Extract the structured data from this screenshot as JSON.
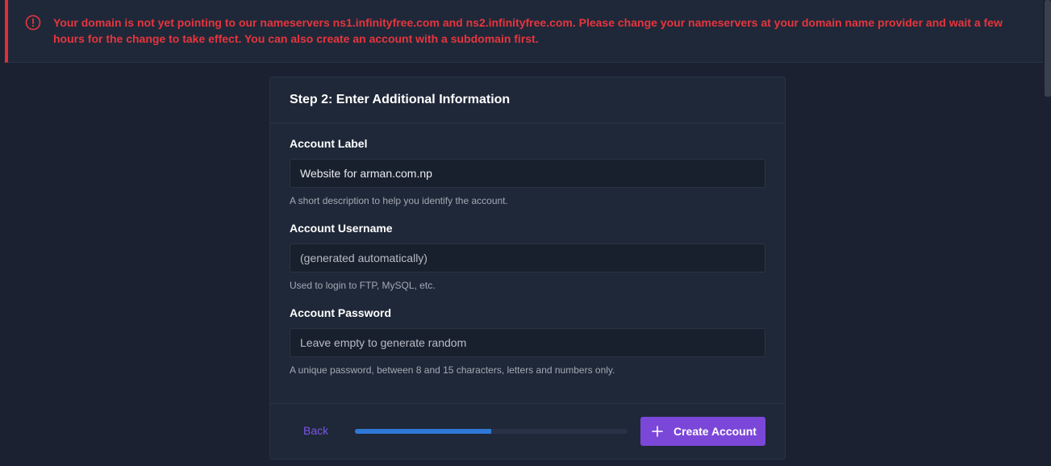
{
  "alert": {
    "icon": "alert-circle-icon",
    "message": "Your domain is not yet pointing to our nameservers ns1.infinityfree.com and ns2.infinityfree.com. Please change your nameservers at your domain name provider and wait a few hours for the change to take effect. You can also create an account with a subdomain first.",
    "color": "#e6353f"
  },
  "card": {
    "title": "Step 2: Enter Additional Information"
  },
  "fields": {
    "label": {
      "label": "Account Label",
      "value": "Website for arman.com.np",
      "placeholder": "",
      "help": "A short description to help you identify the account."
    },
    "username": {
      "label": "Account Username",
      "value": "",
      "placeholder": "(generated automatically)",
      "help": "Used to login to FTP, MySQL, etc."
    },
    "password": {
      "label": "Account Password",
      "value": "",
      "placeholder": "Leave empty to generate random",
      "help": "A unique password, between 8 and 15 characters, letters and numbers only."
    }
  },
  "footer": {
    "back_label": "Back",
    "progress_percent": 50,
    "create_label": "Create Account",
    "create_icon": "plus-icon"
  },
  "colors": {
    "accent": "#7b47d8",
    "progress": "#2f78d6",
    "error": "#e02f3a"
  }
}
